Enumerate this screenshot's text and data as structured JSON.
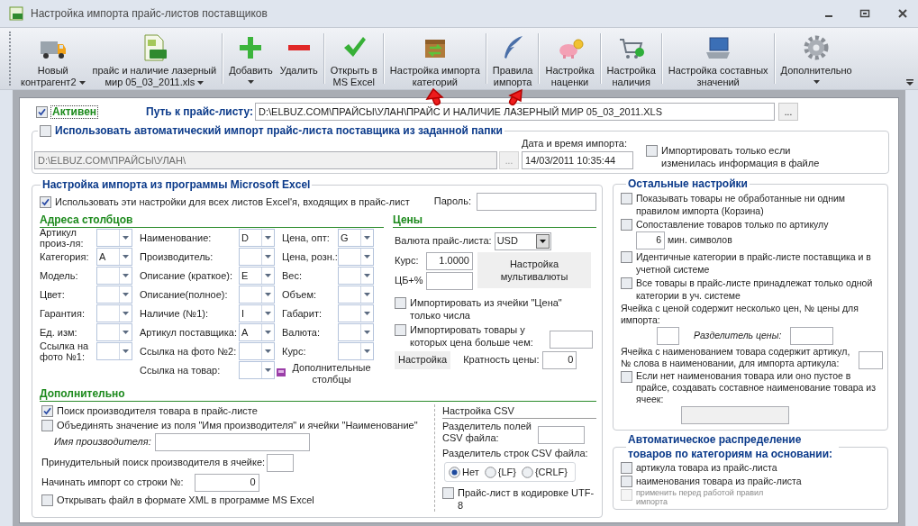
{
  "window": {
    "title": "Настройка импорта прайс-листов поставщиков"
  },
  "toolbar": [
    {
      "label": [
        "Новый",
        "контрагент2"
      ],
      "menu": true,
      "separated": false
    },
    {
      "label": [
        "прайс и наличие лазерный",
        "мир 05_03_2011.xls"
      ],
      "menu": true,
      "separated": false
    },
    {
      "label": [
        "Добавить"
      ],
      "menu": true,
      "separated": true
    },
    {
      "label": [
        "Удалить"
      ],
      "menu": false,
      "separated": false
    },
    {
      "label": [
        "Открыть в",
        "MS Excel"
      ],
      "menu": false,
      "separated": true
    },
    {
      "label": [
        "Настройка импорта",
        "категорий"
      ],
      "menu": false,
      "separated": true
    },
    {
      "label": [
        "Правила",
        "импорта"
      ],
      "menu": false,
      "separated": true
    },
    {
      "label": [
        "Настройка",
        "наценки"
      ],
      "menu": false,
      "separated": true
    },
    {
      "label": [
        "Настройка",
        "наличия"
      ],
      "menu": false,
      "separated": true
    },
    {
      "label": [
        "Настройка составных",
        "значений"
      ],
      "menu": false,
      "separated": true
    },
    {
      "label": [
        "Дополнительно"
      ],
      "menu": true,
      "separated": true
    }
  ],
  "active": {
    "label": "Активен",
    "checked": true
  },
  "path": {
    "label": "Путь к прайс-листу:",
    "value": "D:\\ELBUZ.COM\\ПРАЙСЫ\\УЛАН\\ПРАЙС И НАЛИЧИЕ ЛАЗЕРНЫЙ МИР 05_03_2011.XLS",
    "browse": "..."
  },
  "auto_import": {
    "label": "Использовать автоматический импорт прайс-листа поставщика из заданной папки",
    "checked": false,
    "folder": "D:\\ELBUZ.COM\\ПРАЙСЫ\\УЛАН\\",
    "browse": "...",
    "date_label": "Дата и время импорта:",
    "date": "14/03/2011 10:35:44",
    "only_changed": {
      "label": "Импортировать только если изменилась информация в файле",
      "checked": false
    }
  },
  "excel": {
    "title": "Настройка импорта из программы Microsoft Excel",
    "use_all": {
      "label": "Использовать эти настройки для всех листов Excel'я, входящих в прайс-лист",
      "checked": true
    },
    "password_label": "Пароль:",
    "columns": {
      "title": "Адреса столбцов",
      "groups": [
        [
          {
            "label": "Артикул произ-ля:"
          },
          {
            "label": "Категория:",
            "value": "A"
          },
          {
            "label": "Модель:"
          },
          {
            "label": "Цвет:"
          },
          {
            "label": "Гарантия:"
          },
          {
            "label": "Ед. изм:"
          },
          {
            "label": "Ссылка на фото №1:"
          }
        ],
        [
          {
            "label": "Наименование:",
            "value": "D"
          },
          {
            "label": "Производитель:"
          },
          {
            "label": "Описание (краткое):",
            "value": "E"
          },
          {
            "label": "Описание(полное):"
          },
          {
            "label": "Наличие (№1):",
            "value": "I"
          },
          {
            "label": "Артикул поставщика:",
            "value": "A"
          },
          {
            "label": "Ссылка на фото №2:"
          },
          {
            "label": "Ссылка на товар:"
          }
        ],
        [
          {
            "label": "Цена, опт:",
            "value": "G"
          },
          {
            "label": "Цена, розн.:"
          },
          {
            "label": "Вес:"
          },
          {
            "label": "Объем:"
          },
          {
            "label": "Габарит:"
          },
          {
            "label": "Валюта:"
          },
          {
            "label": "Курс:"
          }
        ]
      ],
      "extra_link": "Дополнительные столбцы"
    },
    "prices": {
      "title": "Цены",
      "currency_label": "Валюта прайс-листа:",
      "currency": "USD",
      "rate_label": "Курс:",
      "rate": "1.0000",
      "cb_label": "ЦБ+%",
      "multicurrency_button": "Настройка мультивалюты",
      "only_numbers": {
        "label": "Импортировать из ячейки \"Цена\" только числа",
        "checked": false
      },
      "price_above": {
        "label": "Импортировать товары у которых цена больше чем:",
        "checked": false
      },
      "settings_button": "Настройка",
      "multiplicity_label": "Кратность цены:",
      "multiplicity": "0"
    },
    "additional": {
      "title": "Дополнительно",
      "find_manufacturer": {
        "label": "Поиск производителя товара в прайс-листе",
        "checked": true
      },
      "merge": {
        "label": "Объединять значение из поля \"Имя производителя\" и ячейки \"Наименование\"",
        "checked": false
      },
      "manufacturer_name_label": "Имя производителя:",
      "forced_label": "Принудительный поиск производителя в ячейке:",
      "start_row_label": "Начинать импорт со строки №:",
      "start_row": "0",
      "open_xml": {
        "label": "Открывать файл в формате XML в программе MS Excel",
        "checked": false
      }
    },
    "csv": {
      "title": "Настройка CSV",
      "field_sep_label": "Разделитель полей CSV файла:",
      "row_sep_label": "Разделитель строк CSV файла:",
      "row_sep_options": [
        {
          "label": "Нет",
          "selected": true
        },
        {
          "label": "{LF}",
          "selected": false
        },
        {
          "label": "{CRLF}",
          "selected": false
        }
      ],
      "utf8": {
        "label": "Прайс-лист в кодировке UTF-8",
        "checked": false
      }
    }
  },
  "other": {
    "title": "Остальные настройки",
    "items": [
      {
        "kind": "checkbox",
        "label": "Показывать товары не обработанные ни одним правилом импорта (Корзина)",
        "checked": false
      },
      {
        "kind": "checkbox_number",
        "label": "Сопоставление товаров только по артикулу",
        "checked": false,
        "value": "6",
        "unit_label": "мин. символов"
      },
      {
        "kind": "checkbox",
        "label": "Идентичные категории в прайс-листе поставщика и в учетной системе",
        "checked": false
      },
      {
        "kind": "checkbox",
        "label": "Все товары в прайс-листе принадлежат только одной категории в уч. системе",
        "checked": false
      },
      {
        "kind": "price_split",
        "label": "Ячейка с ценой содержит несколько цен, № цены для импорта:",
        "separator_label": "Разделитель цены:"
      },
      {
        "kind": "field",
        "label": "Ячейка с наименованием товара содержит артикул, № слова в наименовании, для импорта артикула:"
      },
      {
        "kind": "checkbox_field",
        "label": "Если нет наименования товара или оно пустое в прайсе, создавать составное наименование товара из ячеек:",
        "checked": false
      }
    ]
  },
  "auto_distribution": {
    "title": "Автоматическое распределение товаров по категориям на основании:",
    "items": [
      {
        "label": "артикула товара из прайс-листа",
        "checked": false,
        "disabled": false
      },
      {
        "label": "наименования товара из прайс-листа",
        "checked": false,
        "disabled": false
      },
      {
        "label": "применить перед работой правил импорта",
        "checked": false,
        "disabled": true
      }
    ]
  }
}
